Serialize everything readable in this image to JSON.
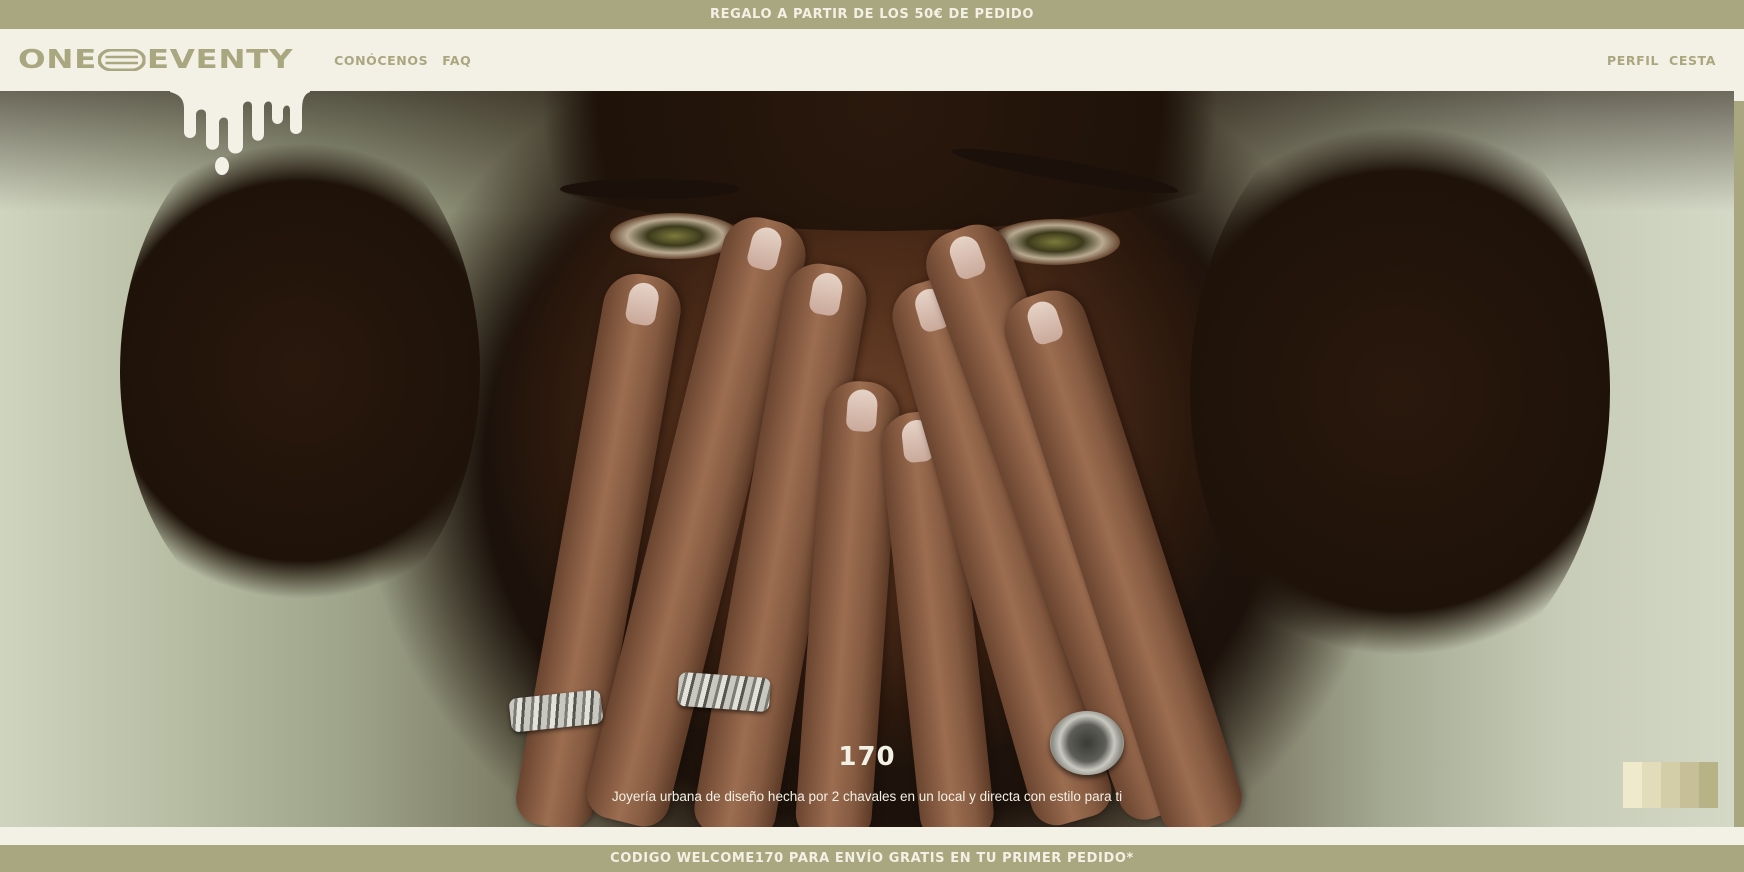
{
  "promo_top": {
    "text": "REGALO A PARTIR DE LOS 50€ DE PEDIDO"
  },
  "header": {
    "logo": {
      "left": "ONE",
      "right": "EVENTY"
    },
    "nav_left": [
      {
        "label": "CONÓCENOS"
      },
      {
        "label": "FAQ"
      }
    ],
    "nav_right": [
      {
        "label": "PERFIL"
      },
      {
        "label": "CESTA"
      }
    ]
  },
  "hero": {
    "title": "170",
    "subtitle": "Joyería urbana de diseño hecha por 2 chavales en un local y directa con estilo para ti",
    "swatch_colors": [
      "#efeacc",
      "#e2dcba",
      "#d3cda8",
      "#c6bf98",
      "#b8b287"
    ]
  },
  "promo_bottom": {
    "text": "CODIGO WELCOME170 PARA ENVÍO GRATIS EN TU PRIMER PEDIDO*"
  },
  "colors": {
    "accent": "#a9a77f",
    "cream": "#f3f1e6"
  }
}
